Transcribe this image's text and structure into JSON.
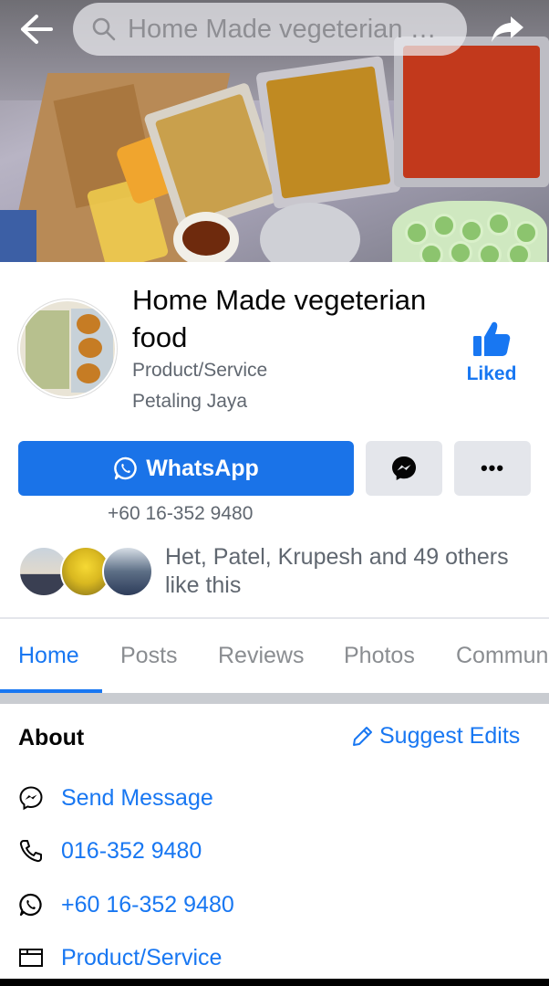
{
  "topbar": {
    "search_text": "Home Made vegeterian food",
    "icons": {
      "back": "back-arrow-icon",
      "search": "search-icon",
      "share": "share-icon"
    }
  },
  "page": {
    "name": "Home Made vegeterian food",
    "category": "Product/Service",
    "location": "Petaling Jaya",
    "like_label": "Liked"
  },
  "actions": {
    "whatsapp_label": "WhatsApp",
    "phone": "+60 16-352 9480",
    "more_label": "•••"
  },
  "social": {
    "likes_text": "Het, Patel, Krupesh and 49 others like this"
  },
  "tabs": [
    {
      "label": "Home",
      "active": true
    },
    {
      "label": "Posts",
      "active": false
    },
    {
      "label": "Reviews",
      "active": false
    },
    {
      "label": "Photos",
      "active": false
    },
    {
      "label": "Community",
      "active": false
    }
  ],
  "about": {
    "title": "About",
    "suggest_edits": "Suggest Edits",
    "rows": [
      {
        "icon": "messenger-icon",
        "text": "Send Message"
      },
      {
        "icon": "phone-icon",
        "text": "016-352 9480"
      },
      {
        "icon": "whatsapp-icon",
        "text": "+60 16-352 9480"
      },
      {
        "icon": "category-icon",
        "text": "Product/Service"
      }
    ]
  },
  "colors": {
    "brand_blue": "#1877f2",
    "whatsapp_button": "#1a73e8",
    "secondary_button": "#e4e6eb",
    "muted_text": "#606770",
    "separator": "#c9ccd1"
  }
}
